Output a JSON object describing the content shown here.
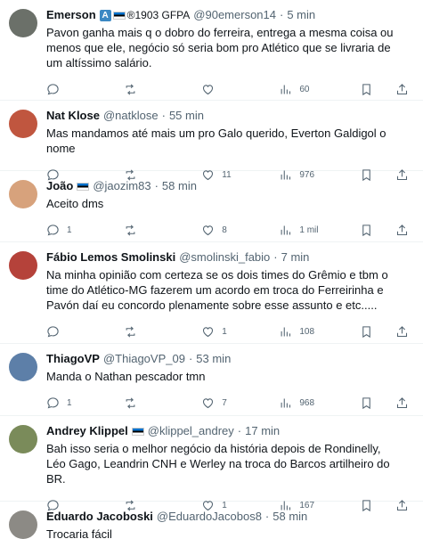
{
  "tweets": [
    {
      "name": "Emerson",
      "badges_text": "®1903 GFPA",
      "handle": "@90emerson14",
      "time": "5 min",
      "text": "Pavon ganha mais q o dobro do ferreira, entrega a mesma coisa ou menos que ele, negócio só seria bom pro Atlético que se livraria de um altíssimo salário.",
      "replies": "",
      "retweets": "",
      "likes": "",
      "views": "60",
      "avatar_color": "#6b7069"
    },
    {
      "name": "Nat Klose",
      "handle": "@natklose",
      "time": "55 min",
      "text": "Mas mandamos até mais um pro Galo querido, Everton Galdigol o nome",
      "replies": "",
      "retweets": "",
      "likes": "11",
      "views": "976",
      "avatar_color": "#c0563f"
    },
    {
      "name": "João",
      "handle": "@jaozim83",
      "time": "58 min",
      "text": "Aceito dms",
      "replies": "1",
      "retweets": "",
      "likes": "8",
      "views": "1 mil",
      "avatar_color": "#d7a27c"
    },
    {
      "name": "Fábio Lemos Smolinski",
      "handle": "@smolinski_fabio",
      "time": "7 min",
      "text": "Na minha opinião com certeza se os dois times do Grêmio e tbm o time do Atlético-MG fazerem um acordo em troca do Ferreirinha e Pavón daí eu concordo plenamente sobre esse assunto e etc.....",
      "replies": "",
      "retweets": "",
      "likes": "1",
      "views": "108",
      "avatar_color": "#b5423a"
    },
    {
      "name": "ThiagoVP",
      "handle": "@ThiagoVP_09",
      "time": "53 min",
      "text": "Manda o Nathan pescador tmn",
      "replies": "1",
      "retweets": "",
      "likes": "7",
      "views": "968",
      "avatar_color": "#5d7fa8"
    },
    {
      "name": "Andrey Klippel",
      "handle": "@klippel_andrey",
      "time": "17 min",
      "text": "Bah isso seria o melhor negócio da história depois de Rondinelly, Léo Gago, Leandrin CNH e Werley na troca do Barcos artilheiro do BR.",
      "replies": "",
      "retweets": "",
      "likes": "1",
      "views": "167",
      "avatar_color": "#7a8b5a"
    },
    {
      "name": "Eduardo Jacoboski",
      "handle": "@EduardoJacobos8",
      "time": "58 min",
      "text": "Trocaria fácil",
      "replies": "",
      "retweets": "",
      "likes": "",
      "views": "",
      "avatar_color": "#8c8a85"
    }
  ],
  "separator_dot": "·",
  "badge_a": "A"
}
